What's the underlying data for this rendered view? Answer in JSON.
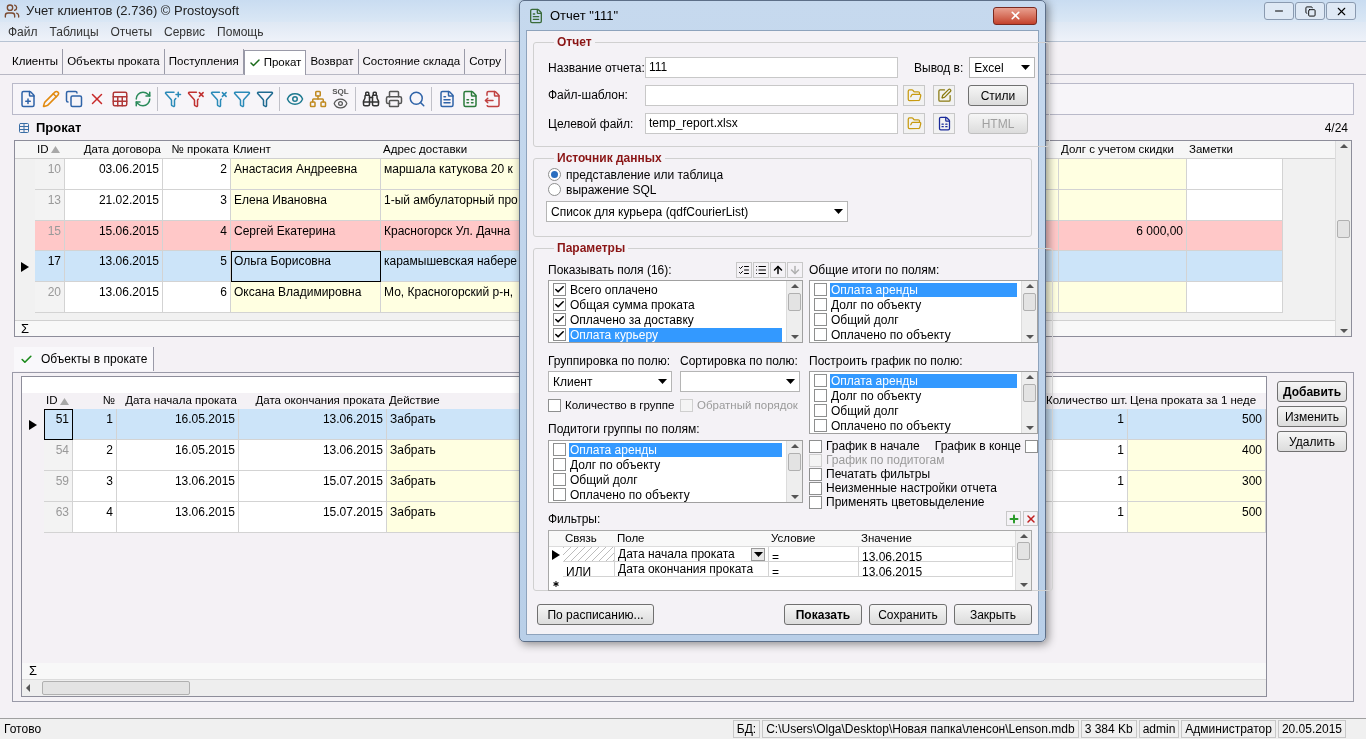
{
  "window": {
    "title": "Учет клиентов (2.736) © Prostoysoft"
  },
  "menu": [
    "Файл",
    "Таблицы",
    "Отчеты",
    "Сервис",
    "Помощь"
  ],
  "tabs": [
    {
      "label": "Клиенты",
      "selected": false
    },
    {
      "label": "Объекты проката",
      "selected": false
    },
    {
      "label": "Поступления",
      "selected": false
    },
    {
      "label": "Прокат",
      "selected": true
    },
    {
      "label": "Возврат",
      "selected": false
    },
    {
      "label": "Состояние склада",
      "selected": false
    },
    {
      "label": "Сотру",
      "selected": false
    }
  ],
  "toolbar": [
    {
      "kind": "new"
    },
    {
      "kind": "edit"
    },
    {
      "kind": "copy"
    },
    {
      "kind": "delete"
    },
    {
      "kind": "delete-table"
    },
    {
      "kind": "refresh"
    },
    {
      "kind": "separator"
    },
    {
      "kind": "filter-add"
    },
    {
      "kind": "filter-remove"
    },
    {
      "kind": "filter-clear"
    },
    {
      "kind": "filter"
    },
    {
      "kind": "filter-save"
    },
    {
      "kind": "separator"
    },
    {
      "kind": "view"
    },
    {
      "kind": "tree"
    },
    {
      "kind": "sql",
      "label": "SQL"
    },
    {
      "kind": "separator"
    },
    {
      "kind": "find"
    },
    {
      "kind": "print"
    },
    {
      "kind": "preview"
    },
    {
      "kind": "separator"
    },
    {
      "kind": "word"
    },
    {
      "kind": "excel"
    },
    {
      "kind": "export"
    }
  ],
  "rentals": {
    "title": "Прокат",
    "counter": "4/24",
    "sum_label": "Σ",
    "columns": [
      "ID",
      "Дата договора",
      "№ проката",
      "Клиент",
      "Адрес доставки"
    ],
    "right_columns": [
      "Долг с учетом скидки",
      "Заметки"
    ],
    "rows": [
      {
        "id": "10",
        "date": "03.06.2015",
        "number": "2",
        "client": "Анастасия Андреевна",
        "address": "маршала катукова 20 к",
        "selected": false,
        "overdue": false
      },
      {
        "id": "13",
        "date": "21.02.2015",
        "number": "3",
        "client": "Елена Ивановна",
        "address": "1-ый амбулаторный про",
        "selected": false,
        "overdue": false
      },
      {
        "id": "15",
        "date": "15.06.2015",
        "number": "4",
        "client": "Сергей Екатерина",
        "address": "Красногорск Ул. Дачна",
        "debt": "6 000,00",
        "selected": false,
        "overdue": true
      },
      {
        "id": "17",
        "date": "13.06.2015",
        "number": "5",
        "client": "Ольга Борисовна",
        "address": "карамышевская набере",
        "selected": true,
        "overdue": false
      },
      {
        "id": "20",
        "date": "13.06.2015",
        "number": "6",
        "client": "Оксана Владимировна",
        "address": "Мо, Красногорский р-н,",
        "selected": false,
        "overdue": false
      }
    ]
  },
  "detail_tab": {
    "label": "Объекты в прокате",
    "selected": true
  },
  "items": {
    "sum_label": "Σ",
    "columns": [
      "ID",
      "№",
      "Дата начала проката",
      "Дата окончания проката",
      "Действие"
    ],
    "right_columns": [
      "Количество шт.",
      "Цена проката за 1 неде"
    ],
    "rows": [
      {
        "id": "51",
        "number": "1",
        "start": "16.05.2015",
        "end": "13.06.2015",
        "action": "Забрать",
        "quantity": "1",
        "price": "500",
        "selected": true
      },
      {
        "id": "54",
        "number": "2",
        "start": "16.05.2015",
        "end": "13.06.2015",
        "action": "Забрать",
        "quantity": "1",
        "price": "400",
        "selected": false
      },
      {
        "id": "59",
        "number": "3",
        "start": "13.06.2015",
        "end": "15.07.2015",
        "action": "Забрать",
        "quantity": "1",
        "price": "300",
        "selected": false
      },
      {
        "id": "63",
        "number": "4",
        "start": "13.06.2015",
        "end": "15.07.2015",
        "action": "Забрать",
        "quantity": "1",
        "price": "500",
        "selected": false
      }
    ],
    "buttons": [
      {
        "label": "Добавить",
        "default": true
      },
      {
        "label": "Изменить",
        "default": false
      },
      {
        "label": "Удалить",
        "default": false
      }
    ]
  },
  "status_bar": {
    "message": "Готово",
    "db_label": "БД:",
    "db_path": "C:\\Users\\Olga\\Desktop\\Новая папка\\ленсон\\Lenson.mdb",
    "size": "3 384 Kb",
    "user": "admin",
    "role": "Администратор",
    "date": "20.05.2015"
  },
  "dialog": {
    "title": "Отчет \"111\"",
    "report": {
      "legend": "Отчет",
      "name_label": "Название отчета:",
      "name_value": "111",
      "output_label": "Вывод в:",
      "output_value": "Excel",
      "template_label": "Файл-шаблон:",
      "target_label": "Целевой файл:",
      "target_value": "temp_report.xlsx",
      "styles_button": {
        "label": "Стили",
        "disabled": false
      },
      "html_button": {
        "label": "HTML",
        "disabled": true
      }
    },
    "source": {
      "legend": "Источник данных",
      "options": [
        {
          "label": "представление или таблица",
          "selected": true
        },
        {
          "label": "выражение SQL",
          "selected": false
        }
      ],
      "query": "Список для курьера (qdfCourierList)"
    },
    "params": {
      "legend": "Параметры",
      "fields_label": "Показывать поля (16):",
      "fields": [
        {
          "label": "Всего оплачено",
          "checked": true,
          "selected": false
        },
        {
          "label": "Общая сумма проката",
          "checked": true,
          "selected": false
        },
        {
          "label": "Оплачено за доставку",
          "checked": true,
          "selected": false
        },
        {
          "label": "Оплата курьеру",
          "checked": true,
          "selected": true
        }
      ],
      "totals_label": "Общие итоги по полям:",
      "totals": [
        {
          "label": "Оплата аренды",
          "checked": false,
          "selected": true
        },
        {
          "label": "Долг по объекту",
          "checked": false,
          "selected": false
        },
        {
          "label": "Общий долг",
          "checked": false,
          "selected": false
        },
        {
          "label": "Оплачено по объекту",
          "checked": false,
          "selected": false
        }
      ],
      "group_label": "Группировка по полю:",
      "group_value": "Клиент",
      "sort_label": "Сортировка по полю:",
      "chart_label": "Построить график по полю:",
      "chart_fields": [
        {
          "label": "Оплата аренды",
          "checked": false,
          "selected": true
        },
        {
          "label": "Долг по объекту",
          "checked": false,
          "selected": false
        },
        {
          "label": "Общий долг",
          "checked": false,
          "selected": false
        },
        {
          "label": "Оплачено по объекту",
          "checked": false,
          "selected": false
        }
      ],
      "group_options": [
        {
          "label": "Количество в группе",
          "checked": false,
          "disabled": false
        },
        {
          "label": "Обратный порядок",
          "checked": false,
          "disabled": true
        }
      ],
      "subtotals_label": "Подитоги группы по полям:",
      "subtotals": [
        {
          "label": "Оплата аренды",
          "checked": false,
          "selected": true
        },
        {
          "label": "Долг по объекту",
          "checked": false,
          "selected": false
        },
        {
          "label": "Общий долг",
          "checked": false,
          "selected": false
        },
        {
          "label": "Оплачено по объекту",
          "checked": false,
          "selected": false
        }
      ],
      "chart_start": {
        "label": "График в начале",
        "checked": false
      },
      "chart_end": {
        "label": "График в конце",
        "checked": false
      },
      "flags": [
        {
          "label": "График по подитогам",
          "checked": false,
          "disabled": true
        },
        {
          "label": "Печатать фильтры",
          "checked": false,
          "disabled": false
        },
        {
          "label": "Неизменные настройки отчета",
          "checked": false,
          "disabled": false
        },
        {
          "label": "Применять цветовыделение",
          "checked": false,
          "disabled": false
        }
      ]
    },
    "filters": {
      "label": "Фильтры:",
      "columns": [
        "Связь",
        "Поле",
        "Условие",
        "Значение"
      ],
      "rows": [
        {
          "field": "Дата начала проката",
          "condition": "=",
          "value": "13.06.2015",
          "selected": true
        },
        {
          "link": "ИЛИ",
          "field": "Дата окончания проката",
          "condition": "=",
          "value": "13.06.2015",
          "selected": false
        }
      ]
    },
    "schedule_button": "По расписанию...",
    "buttons": [
      {
        "label": "Показать",
        "default": true
      },
      {
        "label": "Сохранить",
        "default": false
      },
      {
        "label": "Закрыть",
        "default": false
      }
    ]
  }
}
